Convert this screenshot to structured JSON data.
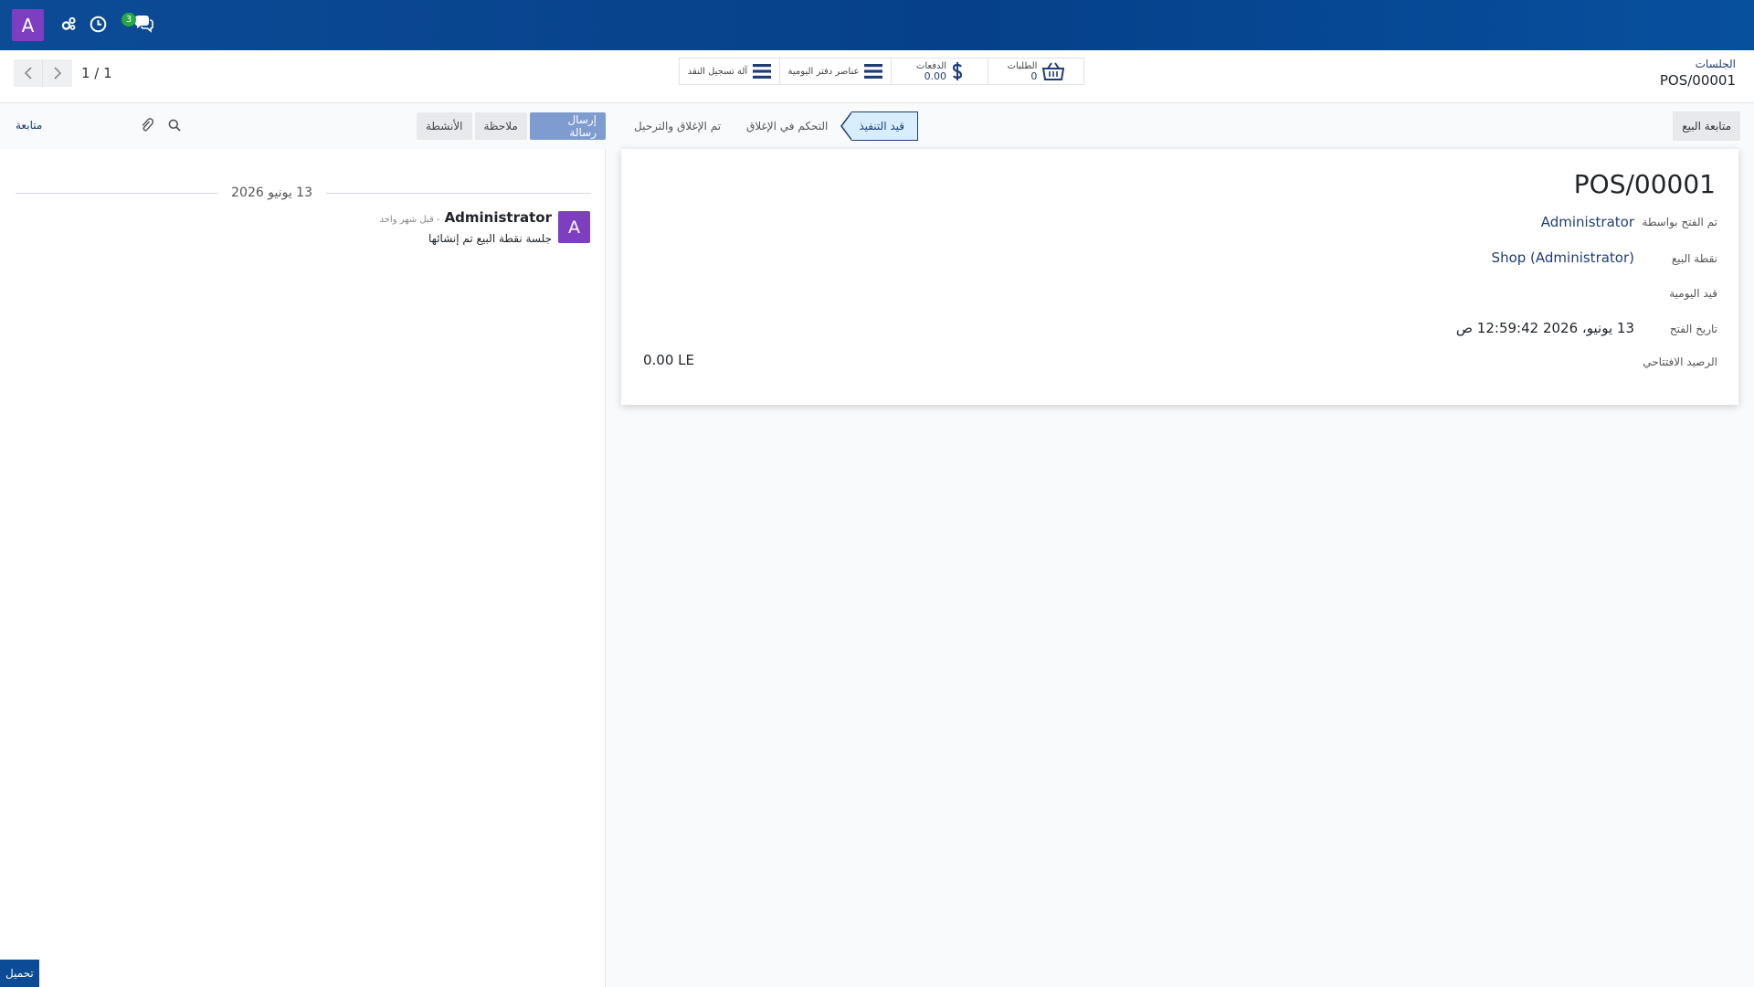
{
  "navbar": {
    "avatar_letter": "A",
    "icons": [
      "settings-icon",
      "clock-icon",
      "chat-icon"
    ],
    "chat_badge": "3",
    "accent_color": "#0c4b96"
  },
  "breadcrumb": {
    "parent": "الجلسات",
    "current": "POS/00001"
  },
  "smart_buttons": {
    "orders_label": "الطلبات",
    "orders_value": "0",
    "payments_label": "الدفعات",
    "payments_value": "0.00",
    "journal_items_label": "عناصر دفتر اليومية",
    "cash_register_label": "آلة تسجيل النقد"
  },
  "pager": {
    "value": "1 / 1"
  },
  "chatter": {
    "follow_label": "متابعة",
    "activities_label": "الأنشطة",
    "note_label": "ملاحظة",
    "send_message_label": "إرسال رسالة",
    "date_separator": "13 يونيو 2026",
    "message": {
      "avatar_letter": "A",
      "author": "Administrator",
      "time": "- قبل شهر واحد",
      "body": "جلسة نقطة البيع تم إنشائها"
    },
    "load_label": "تحميل"
  },
  "statusbar": {
    "continue_selling_label": "متابعة البيع",
    "steps": [
      "تم الإغلاق والترحيل",
      "التحكم في الإغلاق",
      "قيد التنفيذ"
    ],
    "active_step": "قيد التنفيذ"
  },
  "form": {
    "title": "POS/00001",
    "opened_by_label": "تم الفتح بواسطة",
    "opened_by_value": "Administrator",
    "pos_label": "نقطة البيع",
    "pos_value": "Shop (Administrator)",
    "journal_label": "قيد اليومية",
    "opening_date_label": "تاريخ الفتح",
    "opening_date_value": "13 يونيو، 2026 12:59:42 ص",
    "opening_balance_label": "الرصيد الافتتاحي",
    "opening_balance_value": "0.00 LE"
  }
}
